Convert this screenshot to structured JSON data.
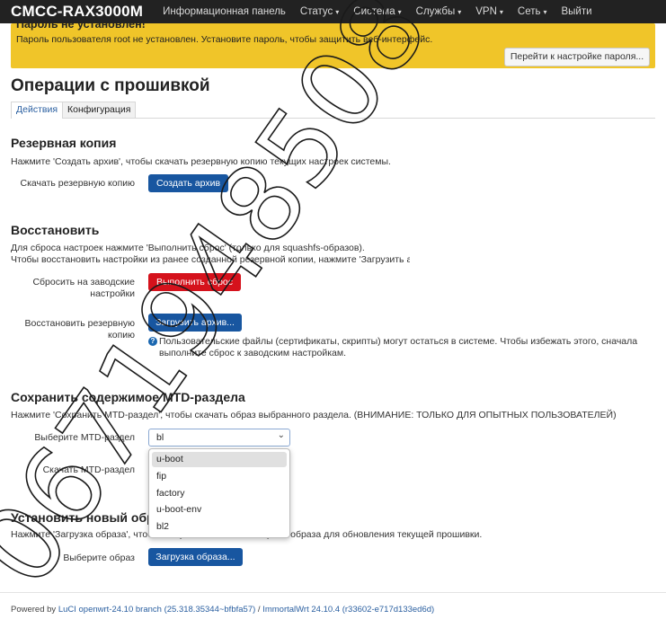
{
  "topbar": {
    "brand": "CMCC-RAX3000M",
    "menu": [
      {
        "label": "Информационная панель",
        "has_caret": false
      },
      {
        "label": "Статус",
        "has_caret": true
      },
      {
        "label": "Система",
        "has_caret": true
      },
      {
        "label": "Службы",
        "has_caret": true
      },
      {
        "label": "VPN",
        "has_caret": true
      },
      {
        "label": "Сеть",
        "has_caret": true
      },
      {
        "label": "Выйти",
        "has_caret": false
      }
    ],
    "caret": "▾"
  },
  "warning": {
    "title": "Пароль не установлен!",
    "text": "Пароль пользователя root не установлен. Установите пароль, чтобы защитить веб-интерфейс.",
    "button": "Перейти к настройке пароля...",
    "color": "#f0c529"
  },
  "page_title": "Операции с прошивкой",
  "tabs": [
    "Действия",
    "Конфигурация"
  ],
  "backup": {
    "title": "Резервная копия",
    "description": "Нажмите 'Создать архив', чтобы скачать резервную копию текущих настроек системы.",
    "label": "Скачать резервную копию",
    "button": "Создать архив"
  },
  "restore": {
    "title": "Восстановить",
    "description_1": "Для сброса настроек нажмите 'Выполнить сброс' (только для squashfs-образов).",
    "description_2": "Чтобы восстановить настройки из ранее созданной резервной копии, нажмите 'Загрузить архив...'.",
    "reset_label_1": "Сбросить на заводские",
    "reset_label_2": "настройки",
    "reset_button": "Выполнить сброс",
    "upload_label_1": "Восстановить резервную",
    "upload_label_2": "копию",
    "upload_button": "Загрузить архив...",
    "help_1": "Пользовательские файлы (сертификаты, скрипты) могут остаться в системе. Чтобы избежать этого, сначала",
    "help_2": "выполните сброс к заводским настройкам.",
    "help_icon": "?"
  },
  "mtd": {
    "title": "Сохранить содержимое MTD-раздела",
    "description": "Нажмите 'Сохранить MTD-раздел', чтобы скачать образ выбранного раздела. (ВНИМАНИЕ: ТОЛЬКО ДЛЯ ОПЫТНЫХ ПОЛЬЗОВАТЕЛЕЙ)",
    "select_label": "Выберите MTD-раздел",
    "selected": "bl",
    "download_label": "Скачать MTD-раздел",
    "options": [
      "u-boot",
      "fip",
      "factory",
      "u-boot-env",
      "bl2"
    ],
    "chevron": "⌄"
  },
  "flash": {
    "title": "Установить новый образ прошивки",
    "description": "Нажмите 'Загрузка образа', чтобы выбрать совместимый файл образа для обновления текущей прошивки.",
    "label": "Выберите образ",
    "button": "Загрузка образа..."
  },
  "footer": {
    "powered": "Powered by",
    "luci": "LuCI openwrt-24.10 branch (25.318.35344~bfbfa57)",
    "sep": "/",
    "immortal": "ImmortalWrt 24.10.4 (r33602-e717d133ed6d)"
  },
  "watermark": "0671948508",
  "colors": {
    "blue_button": "#1856a0",
    "red_button": "#d5121c",
    "topbar": "#222222"
  }
}
